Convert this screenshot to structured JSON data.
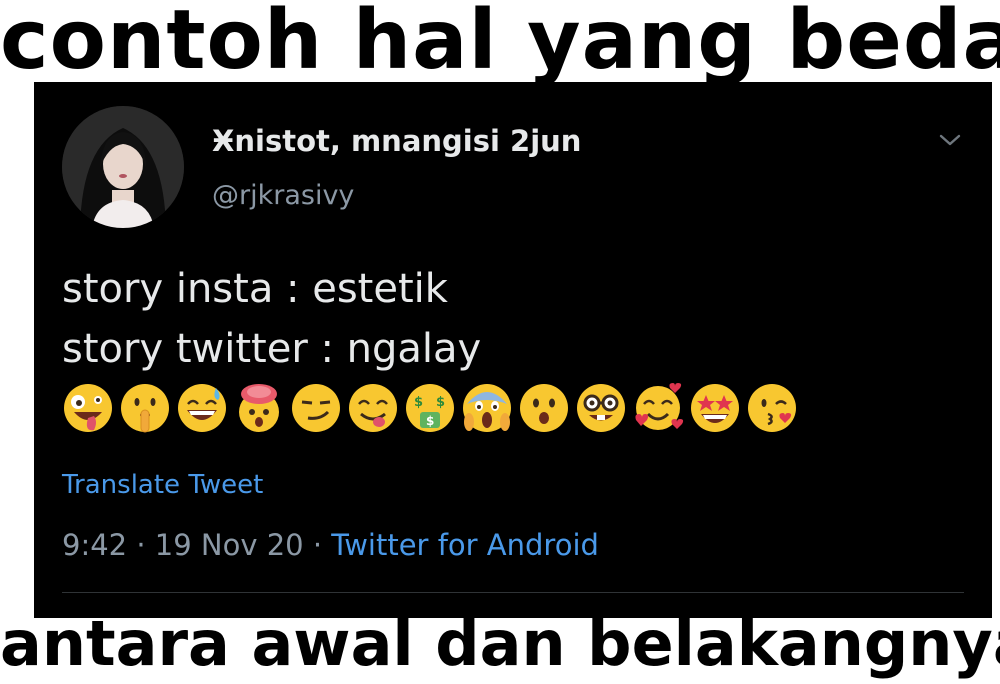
{
  "meme": {
    "caption_top": "contoh hal yang beda",
    "caption_bottom": "antara awal dan belakangnya"
  },
  "tweet": {
    "display_name": "Ӿnistot, mnangisi 2jun",
    "handle": "@rjkrasivy",
    "lines": [
      "story insta : estetik",
      "story twitter : ngalay"
    ],
    "emojis": [
      "zany-face",
      "shushing-face",
      "grinning-sweat-face",
      "exploding-head",
      "smirking-face",
      "face-savoring-food",
      "money-mouth-face",
      "screaming-face",
      "hushed-face",
      "nerd-face",
      "smiling-face-with-hearts",
      "star-struck",
      "face-blowing-kiss"
    ],
    "translate_label": "Translate Tweet",
    "time": "9:42",
    "date": "19 Nov 20",
    "separator": "·",
    "source": "Twitter for Android"
  },
  "colors": {
    "background": "#000000",
    "primary_text": "#e7e9ea",
    "secondary_text": "#8b98a5",
    "link": "#4a99e9",
    "emoji_yellow": "#f8c730"
  }
}
